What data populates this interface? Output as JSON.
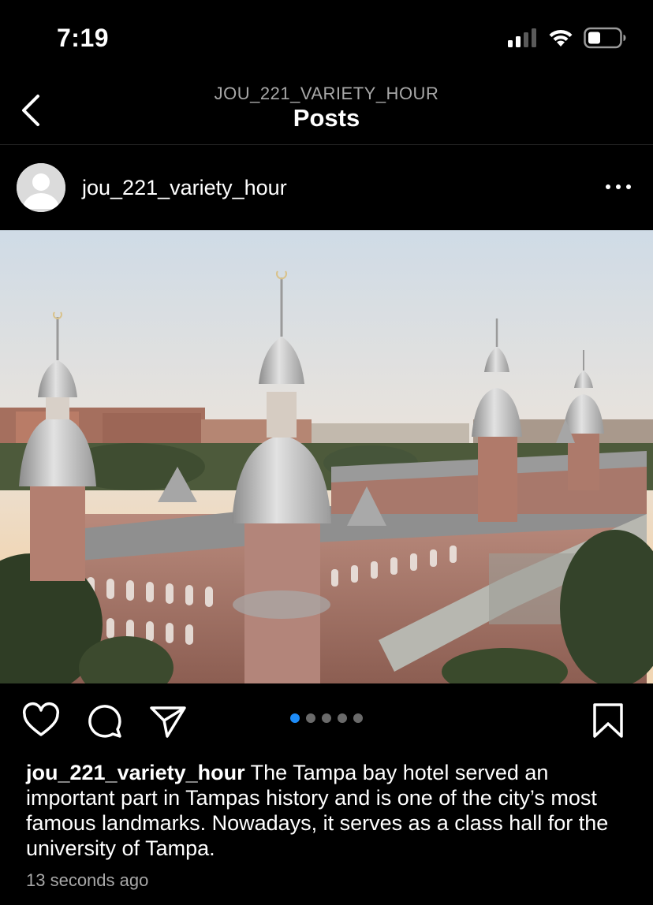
{
  "status_bar": {
    "time": "7:19",
    "signal_icon": "cellular-signal-icon",
    "wifi_icon": "wifi-icon",
    "battery_icon": "battery-icon"
  },
  "header": {
    "subtitle": "JOU_221_VARIETY_HOUR",
    "title": "Posts",
    "back_icon": "chevron-left-icon"
  },
  "post": {
    "username": "jou_221_variety_hour",
    "more_icon": "more-horizontal-icon",
    "image_alt": "Tampa Bay Hotel minarets at sunrise",
    "carousel": {
      "count": 5,
      "active_index": 0
    },
    "actions": [
      "heart-icon",
      "comment-icon",
      "share-icon",
      "bookmark-icon"
    ],
    "caption_user": "jou_221_variety_hour",
    "caption_text": " The Tampa bay hotel served an important part in Tampas history and is one of the city’s most famous landmarks. Nowadays, it serves as a class hall for the university of Tampa.",
    "timestamp": "13 seconds ago"
  },
  "colors": {
    "background": "#000000",
    "text": "#ffffff",
    "muted": "#a8a8a8",
    "carousel_active": "#1d8cf8",
    "carousel_inactive": "#6a6a6a"
  }
}
